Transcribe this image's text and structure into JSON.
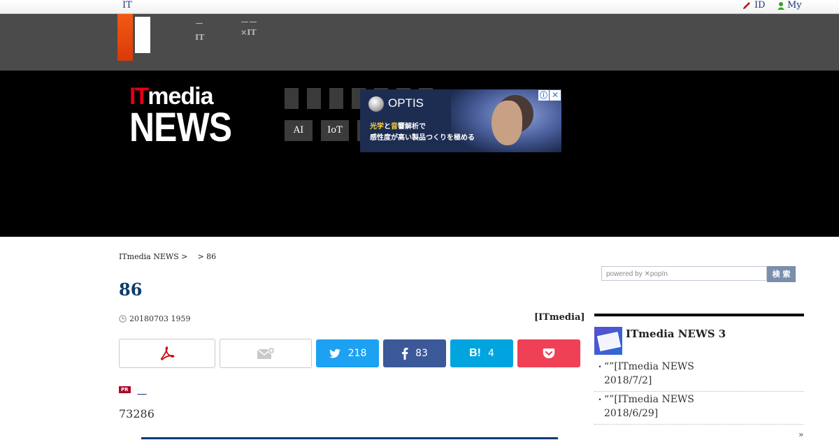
{
  "topbar": {
    "left_link": "IT",
    "id_link": "ID",
    "my_link": "My"
  },
  "subnav": [
    {
      "line1": "ー",
      "line2": "IT"
    },
    {
      "line1": "ーー",
      "line2": "×IT"
    }
  ],
  "header": {
    "logo_it_i": "I",
    "logo_it_t": "T",
    "logo_media": "media",
    "logo_news": "NEWS",
    "tags": [
      "AI",
      "IoT"
    ]
  },
  "ad": {
    "brand": "OPTIS",
    "copy_line1_a": "光学",
    "copy_line1_b": "と",
    "copy_line1_c": "音",
    "copy_line1_d": "響解析で",
    "copy_line2": "感性度が高い製品つくりを極める",
    "info": "ⓘ",
    "close": "✕"
  },
  "breadcrumb": [
    "ITmedia NEWS >",
    "> 86"
  ],
  "article": {
    "title": "86",
    "date": "20180703 1959",
    "source": "[ITmedia]",
    "pr_badge": "PR",
    "pr_text": "＿",
    "body_first": "73286"
  },
  "share": {
    "twitter_count": "218",
    "facebook_count": "83",
    "hatena_label": "B!",
    "hatena_count": "4"
  },
  "sidebar": {
    "search_placeholder": "powered by ✕popIn",
    "search_button": "検 索",
    "ranking_title": "ITmedia NEWS 3",
    "ranking_items": [
      {
        "line1": "“”[ITmedia NEWS",
        "line2": "2018/7/2]"
      },
      {
        "line1": "“”[ITmedia NEWS",
        "line2": "2018/6/29]"
      }
    ],
    "more": "»"
  },
  "colors": {
    "accent_navy": "#0b3b6e",
    "twitter": "#1da1f2",
    "facebook": "#3b5998",
    "hatena": "#00a4de",
    "pocket": "#ef4056",
    "logo_orange": "#f25a16"
  }
}
